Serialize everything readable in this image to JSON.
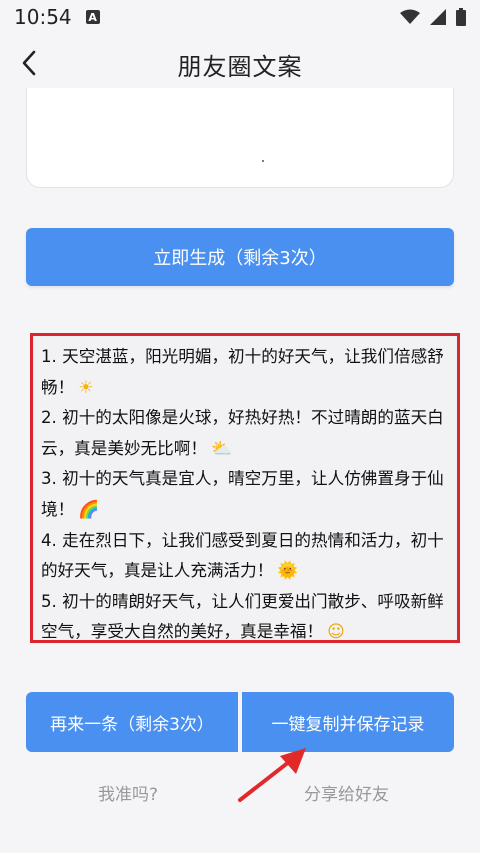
{
  "status": {
    "time": "10:54",
    "notif_letter": "A"
  },
  "header": {
    "title": "朋友圈文案"
  },
  "generate_button": "立即生成（剩余3次）",
  "results": [
    "1. 天空湛蓝，阳光明媚，初十的好天气，让我们倍感舒畅！",
    "2. 初十的太阳像是火球，好热好热！不过晴朗的蓝天白云，真是美妙无比啊！",
    "3. 初十的天气真是宜人，晴空万里，让人仿佛置身于仙境！",
    "4. 走在烈日下，让我们感受到夏日的热情和活力，初十的好天气，真是让人充满活力！",
    "5. 初十的晴朗好天气，让人们更爱出门散步、呼吸新鲜空气，享受大自然的美好，真是幸福！"
  ],
  "result_emojis": [
    "☀",
    "⛅",
    "🌈",
    "🌞",
    "☺"
  ],
  "buttons": {
    "again": "再来一条（剩余3次）",
    "copy_save": "一键复制并保存记录"
  },
  "links": {
    "accurate": "我准吗?",
    "share": "分享给好友"
  },
  "colors": {
    "accent": "#4a90f0",
    "highlight_border": "#d9252b",
    "annotation_arrow": "#e02a2a"
  }
}
